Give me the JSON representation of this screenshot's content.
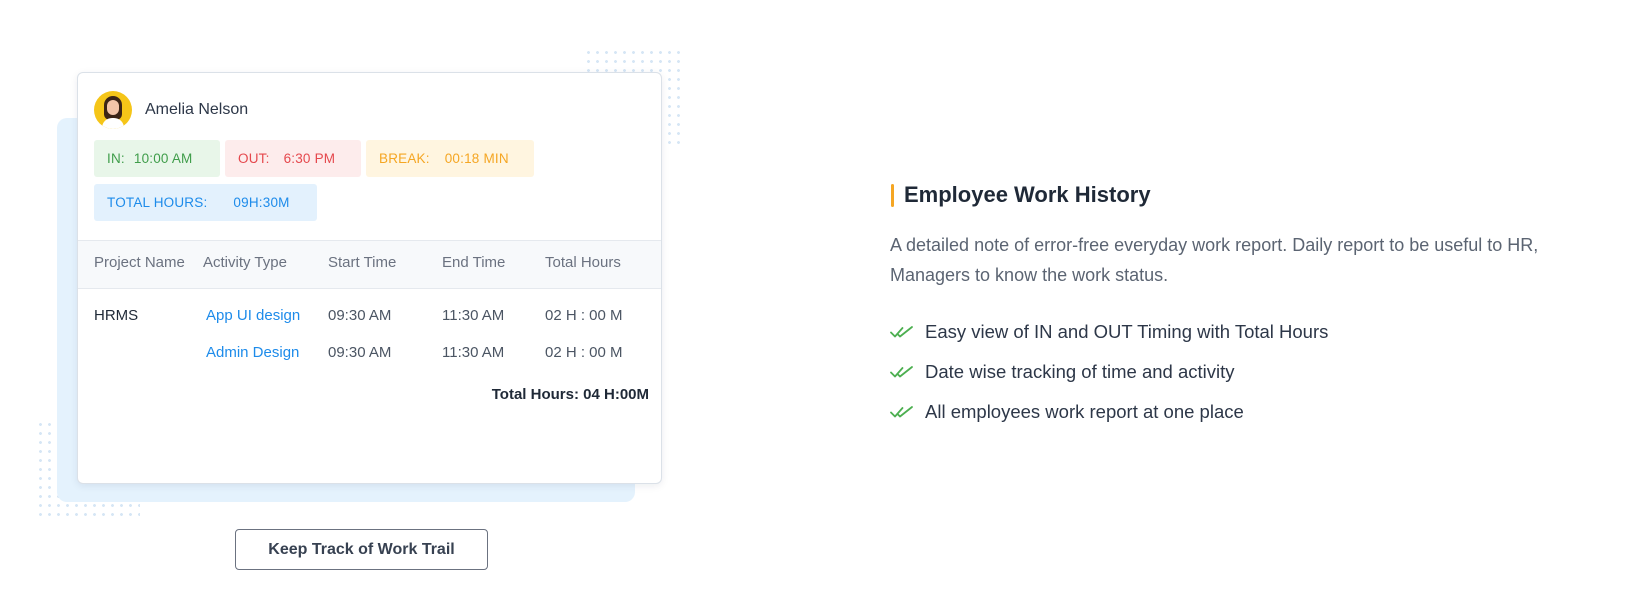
{
  "card": {
    "user_name": "Amelia Nelson",
    "chips": {
      "in_label": "IN:",
      "in_value": "10:00 AM",
      "out_label": "OUT:",
      "out_value": "6:30 PM",
      "break_label": "BREAK:",
      "break_value": "00:18 MIN",
      "total_label": "TOTAL HOURS:",
      "total_value": "09H:30M"
    },
    "table": {
      "headers": [
        "Project Name",
        "Activity Type",
        "Start Time",
        "End Time",
        "Total Hours"
      ],
      "rows": [
        [
          "HRMS",
          "App UI design",
          "09:30 AM",
          "11:30 AM",
          "02 H : 00 M"
        ],
        [
          "",
          "Admin Design",
          "09:30 AM",
          "11:30 AM",
          "02 H : 00 M"
        ]
      ],
      "total": "Total Hours: 04 H:00M"
    }
  },
  "cta_label": "Keep Track of Work Trail",
  "section": {
    "title": "Employee Work History",
    "description": "A detailed note of error-free everyday work report. Daily report to be useful to HR, Managers to know the work status.",
    "features": [
      "Easy view of IN and OUT Timing with Total Hours",
      "Date wise tracking of time and activity",
      "All employees work report at one place"
    ]
  },
  "colors": {
    "accent": "#f5a623",
    "in": "#3f9d4a",
    "out": "#e5484d",
    "break": "#f5a623",
    "total": "#1d8bea",
    "check": "#4caf50"
  },
  "icons": {
    "feature_check": "double-check-icon",
    "avatar": "avatar"
  }
}
